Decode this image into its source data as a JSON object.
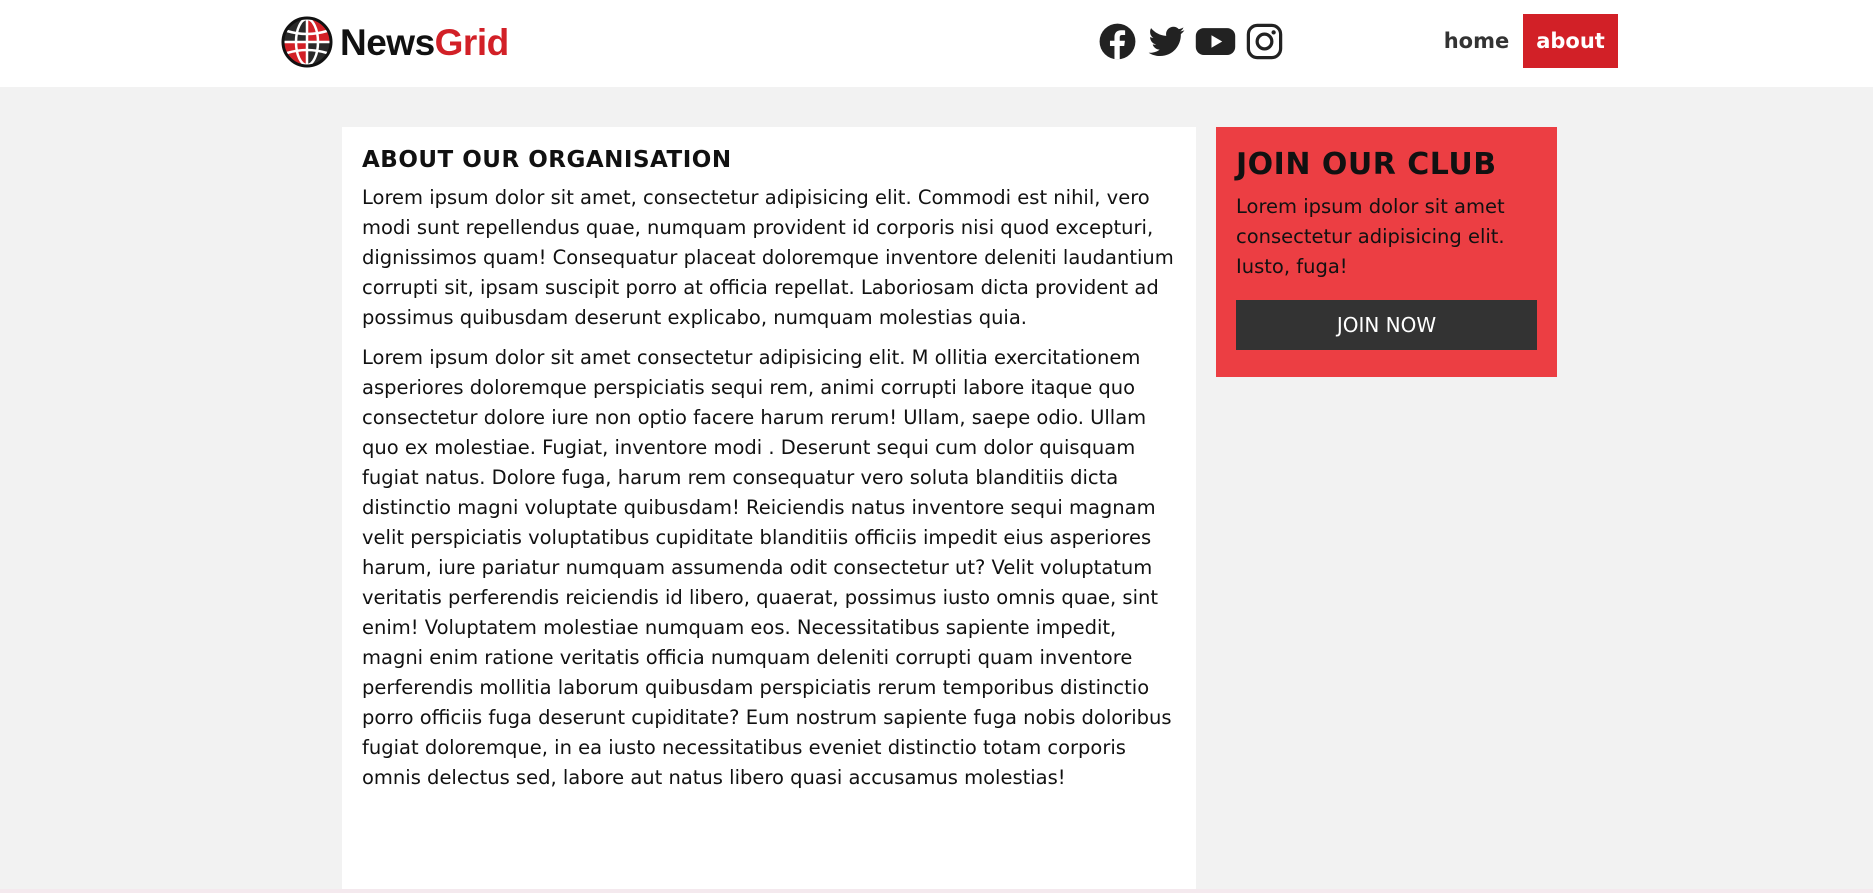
{
  "header": {
    "brand": {
      "part1": "News",
      "part2": "Grid",
      "icon": "globe-icon"
    },
    "socials": [
      {
        "icon": "facebook-icon"
      },
      {
        "icon": "twitter-icon"
      },
      {
        "icon": "youtube-icon"
      },
      {
        "icon": "instagram-icon"
      }
    ],
    "nav": {
      "home": "home",
      "about": "about"
    }
  },
  "main": {
    "title": "ABOUT OUR ORGANISATION",
    "paragraph1": "Lorem ipsum dolor sit amet, consectetur adipisicing elit. Commodi est nihil, vero modi sunt repellendus quae, numquam provident id corporis nisi quod excepturi, dignissimos quam! Consequatur placeat doloremque inventore deleniti laudantium corrupti sit, ipsam suscipit porro at officia repellat. Laboriosam dicta provident ad possimus quibusdam deserunt explicabo, numquam molestias quia.",
    "paragraph2": "Lorem ipsum dolor sit amet consectetur adipisicing elit. M ollitia exercitationem asperiores doloremque perspiciatis sequi rem, animi corrupti labore itaque quo consectetur dolore iure non optio facere harum rerum! Ullam, saepe odio. Ullam quo ex molestiae. Fugiat, inventore modi . Deserunt sequi cum dolor quisquam fugiat natus. Dolore fuga, harum rem consequatur vero soluta blanditiis dicta distinctio magni voluptate quibusdam! Reiciendis natus inventore sequi magnam velit perspiciatis voluptatibus cupiditate blanditiis officiis impedit eius asperiores harum, iure pariatur numquam assumenda odit consectetur ut? Velit voluptatum veritatis perferendis reiciendis id libero, quaerat, possimus iusto omnis quae, sint enim! Voluptatem molestiae numquam eos. Necessitatibus sapiente impedit, magni enim ratione veritatis officia numquam deleniti corrupti quam inventore perferendis mollitia laborum quibusdam perspiciatis rerum temporibus distinctio porro officiis fuga deserunt cupiditate? Eum nostrum sapiente fuga nobis doloribus fugiat doloremque, in ea iusto necessitatibus eveniet distinctio totam corporis omnis delectus sed, labore aut natus libero quasi accusamus molestias!"
  },
  "sidebar": {
    "title": "JOIN OUR CLUB",
    "text": "Lorem ipsum dolor sit amet consectetur adipisicing elit. Iusto, fuga!",
    "button": "JOIN NOW"
  },
  "colors": {
    "brand_red": "#d22027",
    "club_bg": "#ec3e43",
    "button_bg": "#333333",
    "page_bg": "#f2f2f2"
  }
}
